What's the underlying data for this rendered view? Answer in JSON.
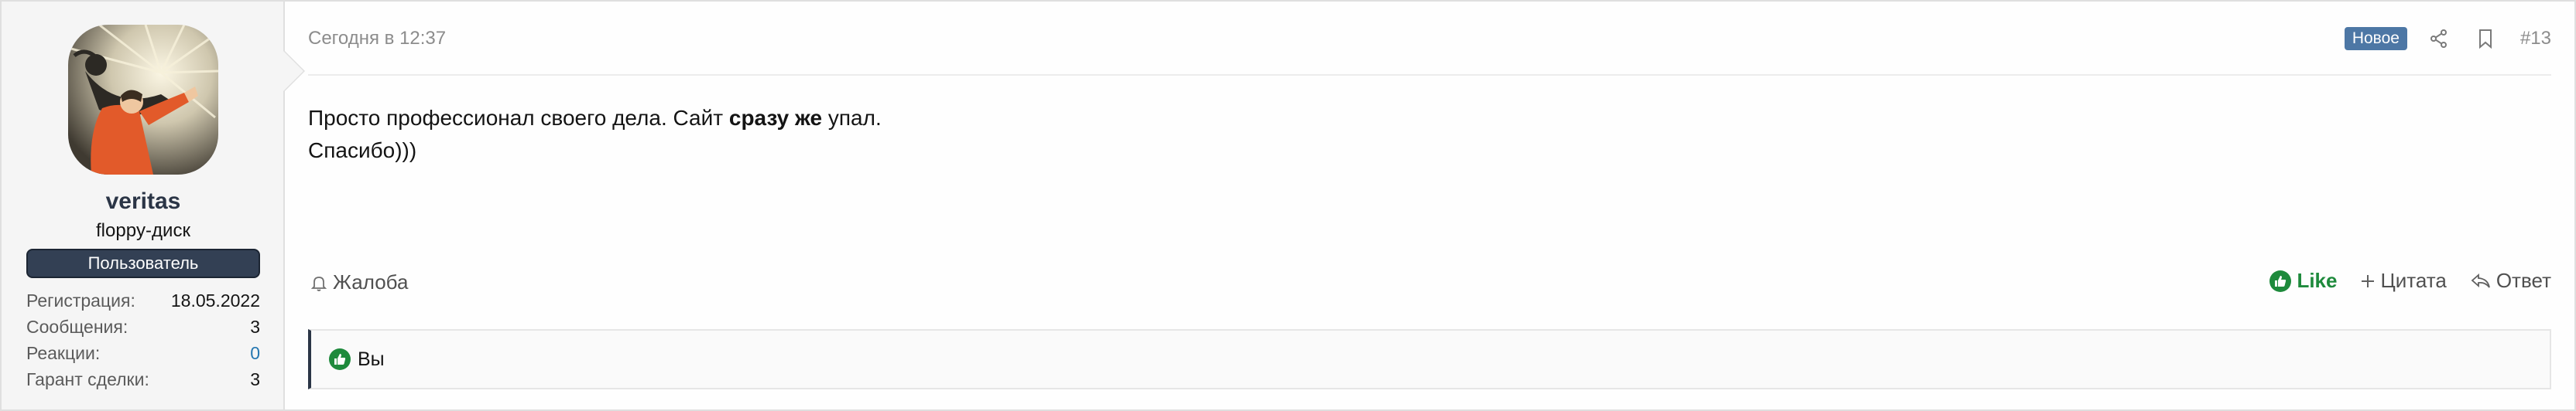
{
  "user": {
    "name": "veritas",
    "title": "floppy-диск",
    "banner": "Пользователь",
    "stats": [
      {
        "label": "Регистрация:",
        "value": "18.05.2022"
      },
      {
        "label": "Сообщения:",
        "value": "3"
      },
      {
        "label": "Реакции:",
        "value": "0"
      },
      {
        "label": "Гарант сделки:",
        "value": "3"
      }
    ]
  },
  "post": {
    "date": "Сегодня в 12:37",
    "badge": "Новое",
    "number": "#13",
    "body": {
      "line1_before": "Просто профессионал своего дела. Сайт ",
      "line1_bold": "сразу же",
      "line1_after": " упал.",
      "line2": "Спасибо)))"
    }
  },
  "actions": {
    "report": "Жалоба",
    "like": "Like",
    "quote": "Цитата",
    "reply": "Ответ"
  },
  "reactions": {
    "text": "Вы"
  },
  "colors": {
    "accent": "#2b3546",
    "badge": "#4d77a5",
    "like": "#1e8a3c",
    "link": "#2577b1"
  },
  "icons": [
    "share-icon",
    "bookmark-icon",
    "bell-icon",
    "thumbs-up-icon",
    "plus-icon",
    "reply-icon"
  ]
}
